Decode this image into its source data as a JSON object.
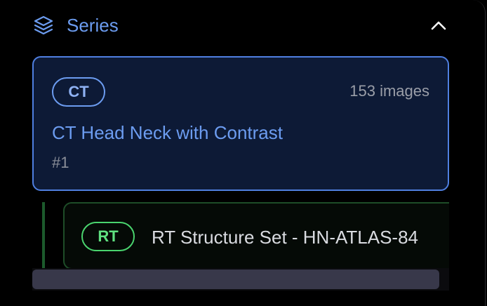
{
  "section": {
    "title": "Series",
    "icon": "layers-icon",
    "toggle_icon": "chevron-up-icon",
    "accent_color": "#6c9cf0"
  },
  "series": [
    {
      "modality": "CT",
      "image_count": "153 images",
      "title": "CT Head Neck with Contrast",
      "number": "#1",
      "selected": true,
      "children": [
        {
          "modality": "RT",
          "title": "RT Structure Set - HN-ATLAS-84"
        }
      ]
    }
  ],
  "colors": {
    "ct_badge": "#6c9cf0",
    "rt_badge": "#4ad46e",
    "selected_border": "#4f7fe0"
  }
}
